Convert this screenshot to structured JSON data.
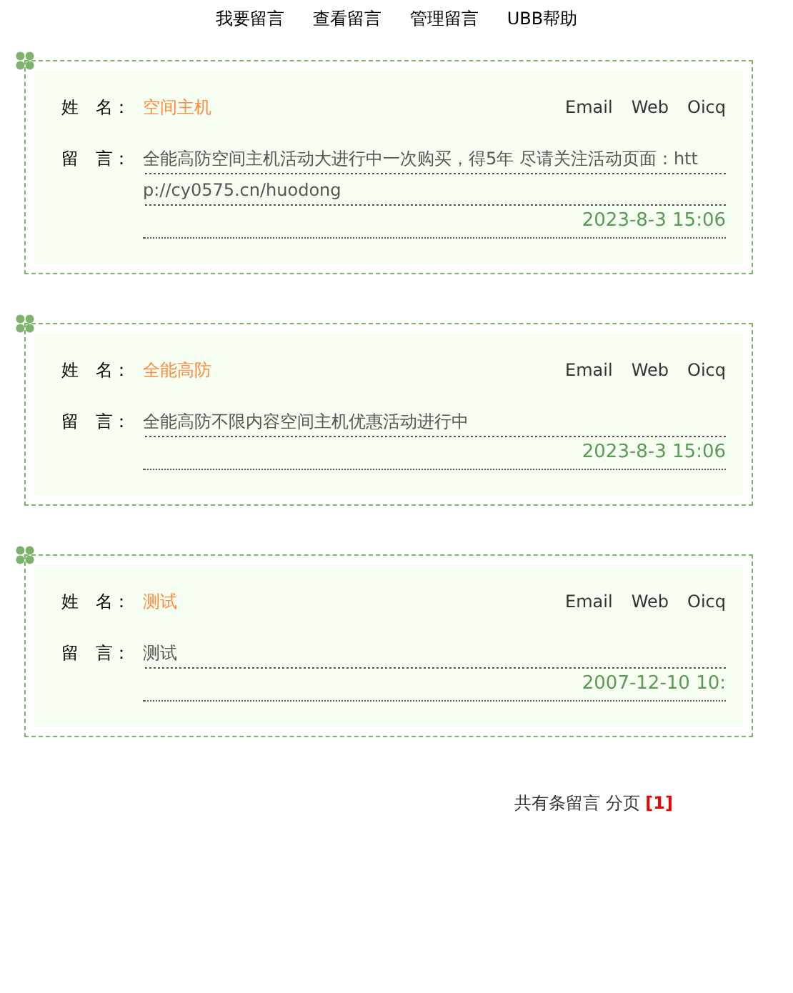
{
  "nav": [
    "我要留言",
    "查看留言",
    "管理留言",
    "UBB帮助"
  ],
  "entries": [
    {
      "name_label": "姓　名：",
      "name": "空间主机",
      "links": [
        "Email",
        "Web",
        "Oicq"
      ],
      "message_label": "留　言：",
      "message": "全能高防空间主机活动大进行中一次购买，得5年 尽请关注活动页面：http://cy0575.cn/huodong",
      "time": "2023-8-3 15:06"
    },
    {
      "name_label": "姓　名：",
      "name": "全能高防",
      "links": [
        "Email",
        "Web",
        "Oicq"
      ],
      "message_label": "留　言：",
      "message": "全能高防不限内容空间主机优惠活动进行中",
      "time": "2023-8-3 15:06"
    },
    {
      "name_label": "姓　名：",
      "name": "测试",
      "links": [
        "Email",
        "Web",
        "Oicq"
      ],
      "message_label": "留　言：",
      "message": "测试",
      "time": "2007-12-10 10:"
    }
  ],
  "pagination": "共有条留言 分页 **[1]**"
}
